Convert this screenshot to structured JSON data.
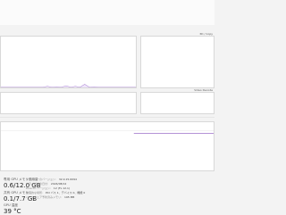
{
  "engine_chart_labels": {
    "top_right": "3D / Copy",
    "bottom_right": "Video Decode"
  },
  "top_tick": "0%",
  "middle_tick": "0%",
  "stats_left": {
    "row1_label": "専用 GPU メモリ使用量",
    "row1_value": "0.6/12.0 GB",
    "row2_label": "共有 GPU メモリ",
    "row2_value": "0.1/7.7 GB",
    "row3_label": "GPU 温度",
    "row3_value": "39 °C"
  },
  "stats_mid": {
    "l1": "ドライバーのバージョン:",
    "l2": "ドライバーの日付:",
    "l3": "DirectX バージョン:",
    "l4": "物理的な場所:",
    "l5": "ハードウェア予約済みメモリ:"
  },
  "stats_mid_vals": {
    "v1": "32.0.15.6094",
    "v2": "2024/08/14",
    "v3": "12 (FL 12.1)",
    "v4": "PCI バス 1、デバイス 0、機能 0",
    "v5": "195 MB"
  },
  "chart_data": {
    "type": "line",
    "series": [
      {
        "values": [
          0,
          0,
          0,
          0,
          0,
          0,
          0,
          0,
          0,
          0,
          2,
          0,
          1,
          0,
          3,
          0,
          2,
          0,
          6,
          0,
          1,
          0,
          0,
          0,
          0,
          0,
          0,
          0,
          0,
          0
        ]
      }
    ],
    "ylim": [
      0,
      100
    ]
  }
}
